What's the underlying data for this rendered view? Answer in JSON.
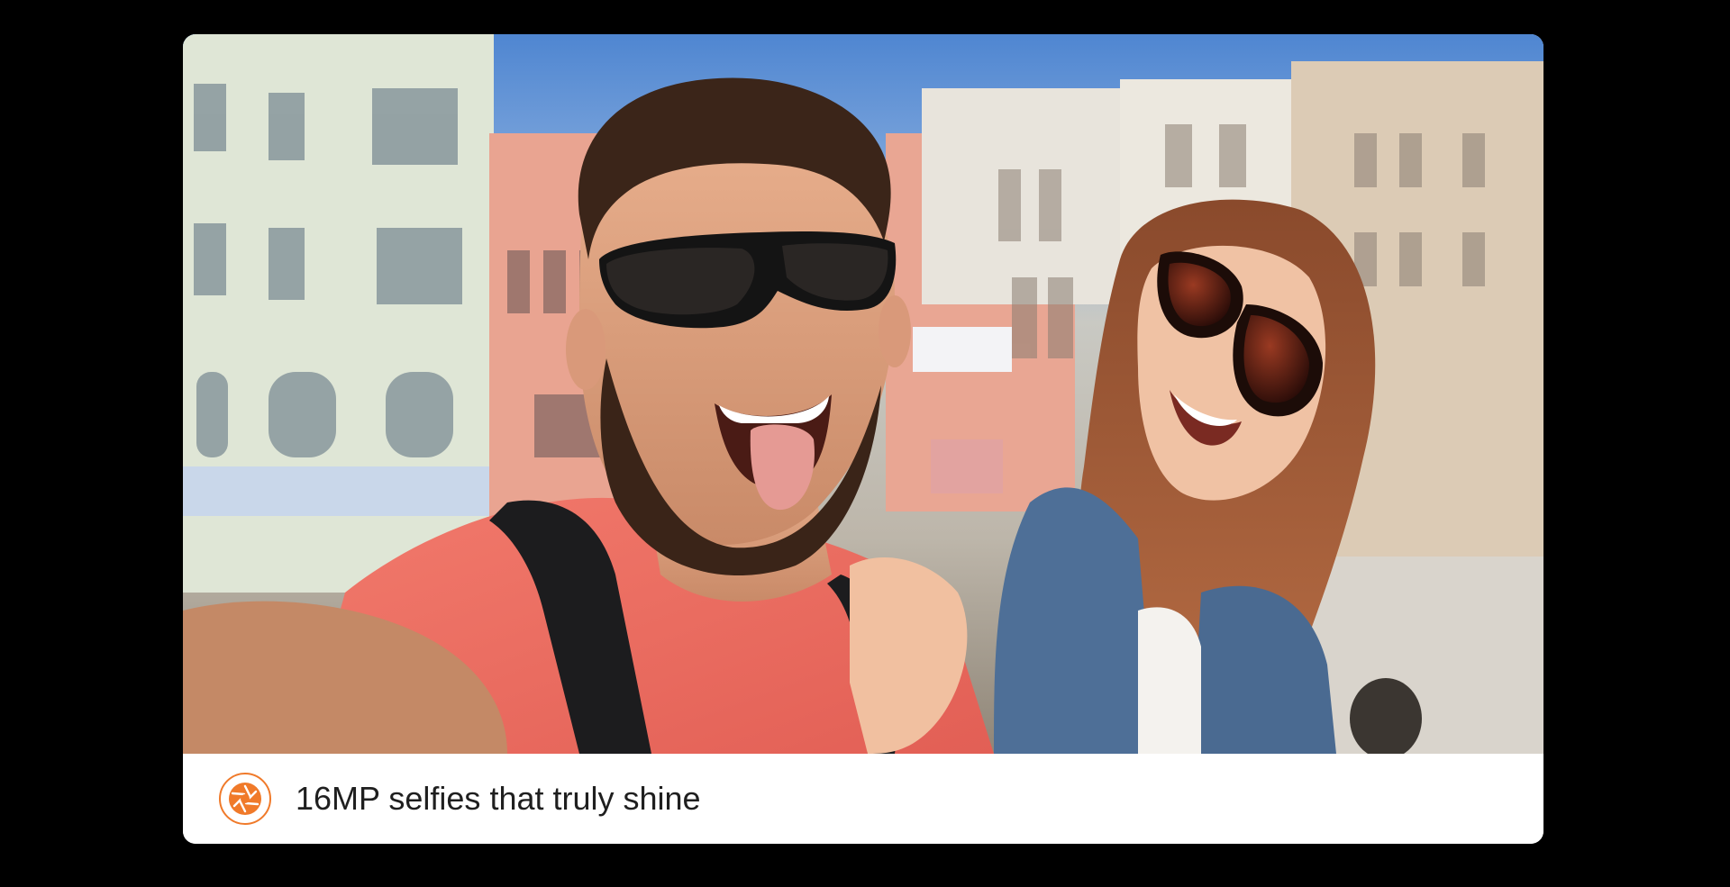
{
  "caption": {
    "text": "16MP selfies that truly shine",
    "icon": "camera-aperture-icon"
  },
  "photo": {
    "subject": "selfie-photo"
  },
  "colors": {
    "background": "#000000",
    "card": "#ffffff",
    "accent": "#f07a2a",
    "text": "#1f1f1f"
  }
}
